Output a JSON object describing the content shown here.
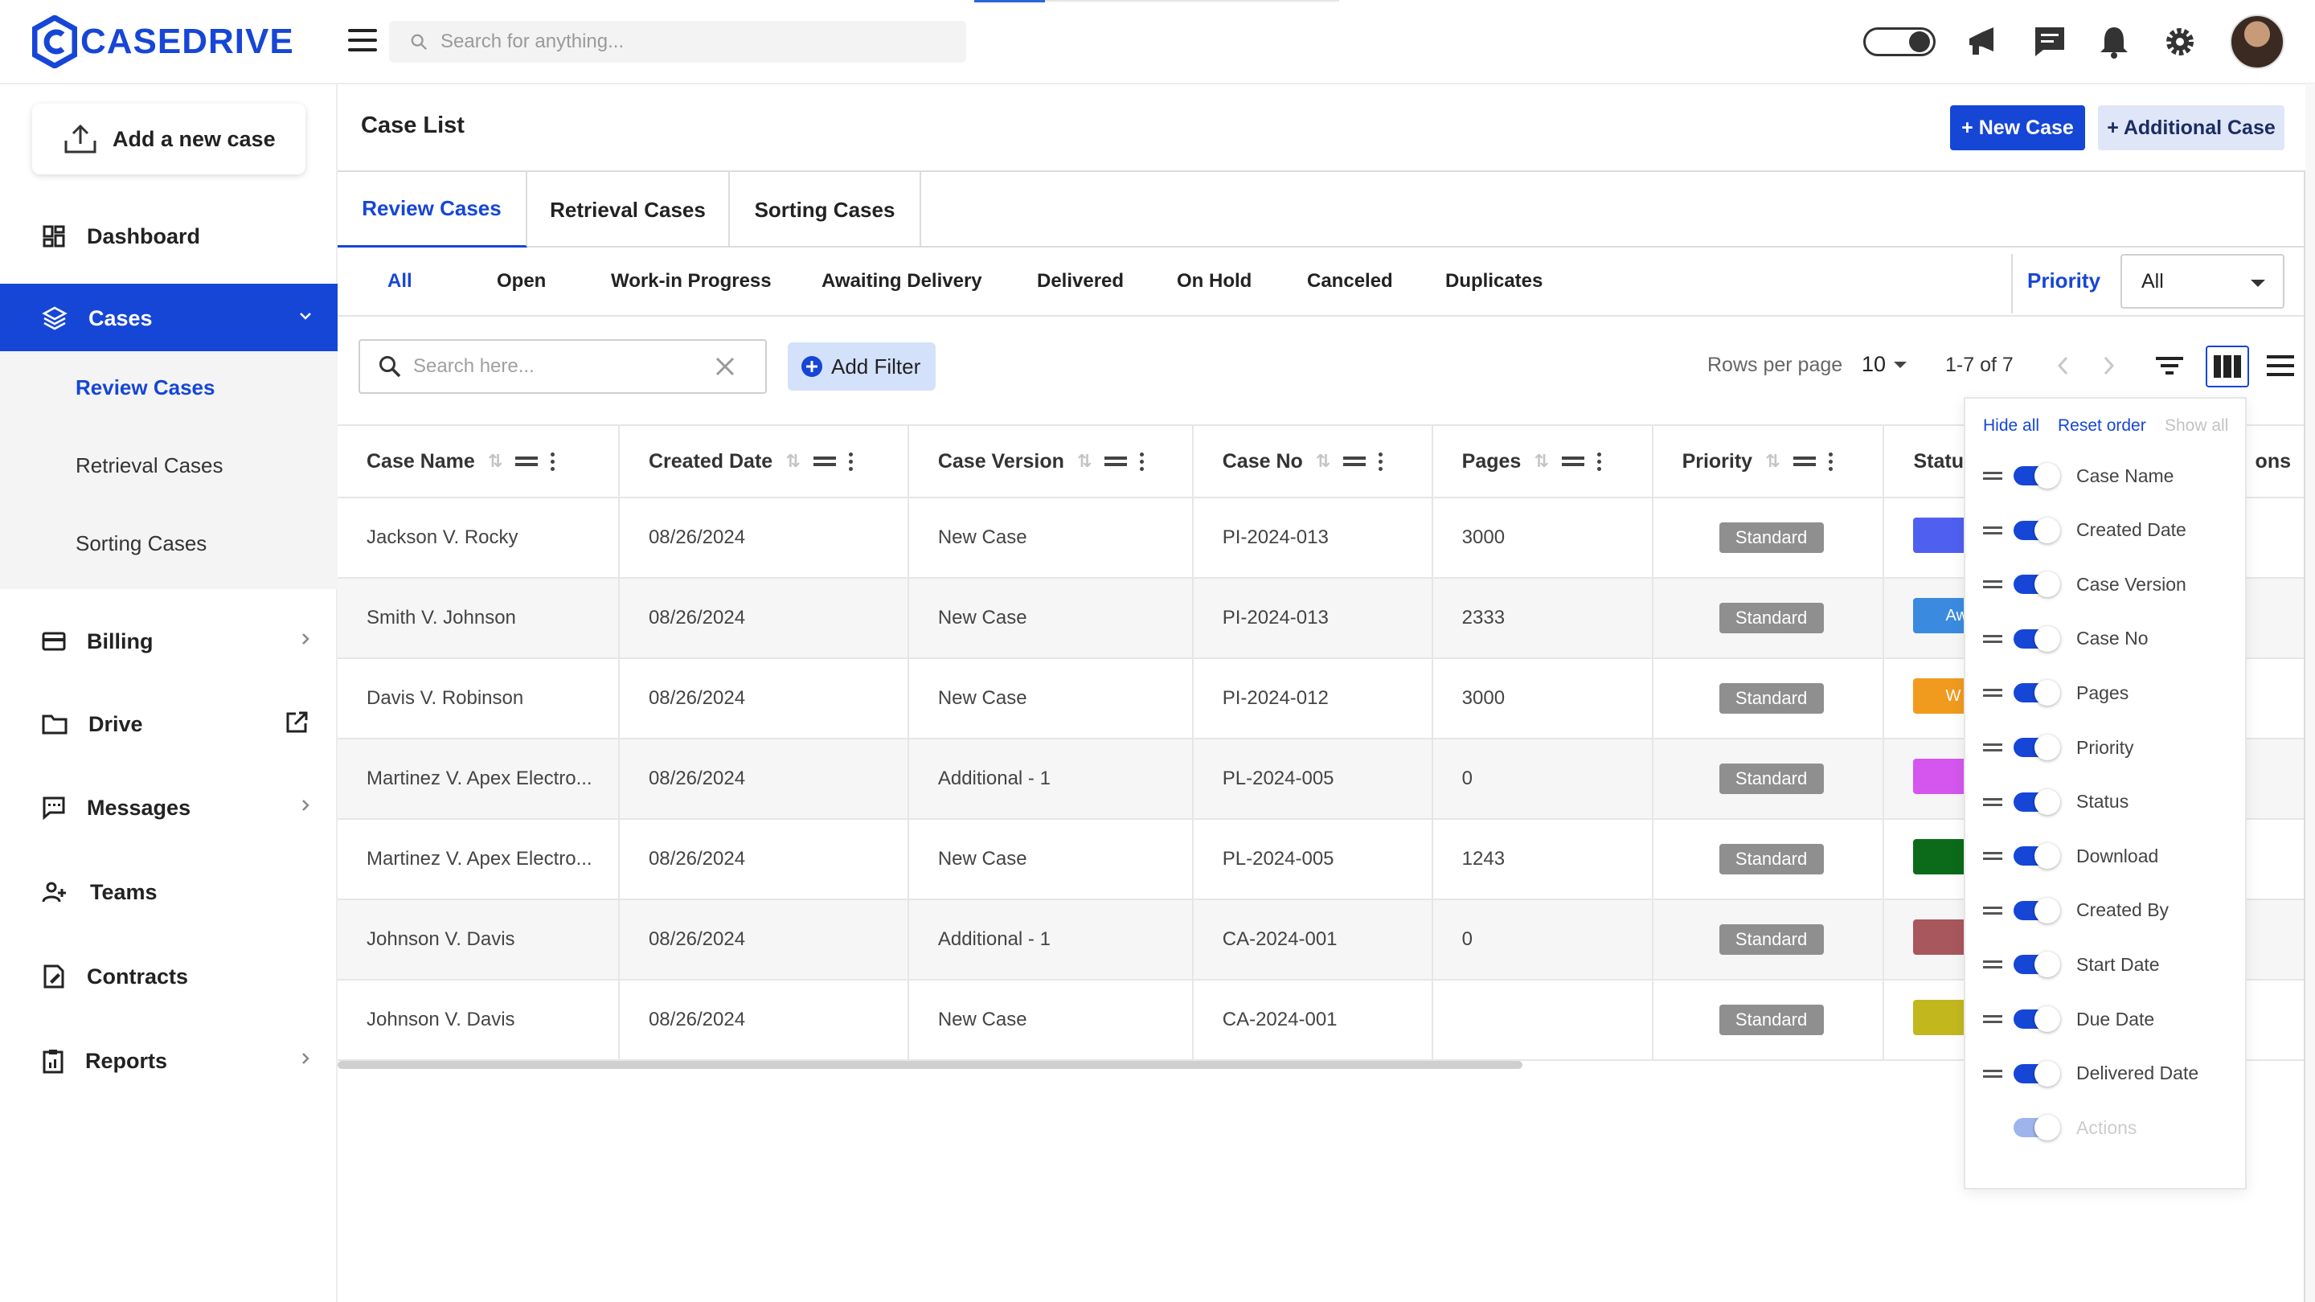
{
  "brand": {
    "logo_text": "CASEDRIVE",
    "accent": "#1646d6"
  },
  "topbar": {
    "search_placeholder": "Search for anything...",
    "icons": [
      "theme-toggle-icon",
      "megaphone-icon",
      "chat-icon",
      "bell-icon",
      "gear-icon",
      "avatar"
    ]
  },
  "sidebar": {
    "add_case_label": "Add a new case",
    "items": [
      {
        "label": "Dashboard",
        "icon": "dashboard-icon"
      },
      {
        "label": "Cases",
        "icon": "layers-icon"
      },
      {
        "label": "Billing",
        "icon": "card-icon"
      },
      {
        "label": "Drive",
        "icon": "folder-icon"
      },
      {
        "label": "Messages",
        "icon": "message-icon"
      },
      {
        "label": "Teams",
        "icon": "team-icon"
      },
      {
        "label": "Contracts",
        "icon": "contract-icon"
      },
      {
        "label": "Reports",
        "icon": "report-icon"
      }
    ],
    "cases_sub": [
      "Review Cases",
      "Retrieval Cases",
      "Sorting Cases"
    ]
  },
  "header": {
    "title": "Case List",
    "new_case_label": "+ New Case",
    "additional_case_label": "+ Additional Case"
  },
  "tabs": [
    "Review Cases",
    "Retrieval Cases",
    "Sorting Cases"
  ],
  "status_filters": [
    "All",
    "Open",
    "Work-in Progress",
    "Awaiting Delivery",
    "Delivered",
    "On Hold",
    "Canceled",
    "Duplicates"
  ],
  "priority": {
    "label": "Priority",
    "value": "All"
  },
  "toolbar": {
    "search_placeholder": "Search here...",
    "add_filter_label": "Add Filter",
    "rows_per_page_label": "Rows per page",
    "rows_per_page_value": "10",
    "page_range": "1-7 of 7"
  },
  "table": {
    "columns": [
      "Case Name",
      "Created Date",
      "Case Version",
      "Case No",
      "Pages",
      "Priority",
      "Statu",
      "ons"
    ],
    "rows": [
      {
        "case_name": "Jackson V. Rocky",
        "created": "08/26/2024",
        "version": "New Case",
        "case_no": "PI-2024-013",
        "pages": "3000",
        "priority": "Standard",
        "status_color": "#4f5ff0",
        "status_text": ""
      },
      {
        "case_name": "Smith V. Johnson",
        "created": "08/26/2024",
        "version": "New Case",
        "case_no": "PI-2024-013",
        "pages": "2333",
        "priority": "Standard",
        "status_color": "#3a8be0",
        "status_text": "Aw"
      },
      {
        "case_name": "Davis V. Robinson",
        "created": "08/26/2024",
        "version": "New Case",
        "case_no": "PI-2024-012",
        "pages": "3000",
        "priority": "Standard",
        "status_color": "#f09a1e",
        "status_text": "W"
      },
      {
        "case_name": "Martinez V. Apex Electro...",
        "created": "08/26/2024",
        "version": "Additional - 1",
        "case_no": "PL-2024-005",
        "pages": "0",
        "priority": "Standard",
        "status_color": "#d456ee",
        "status_text": ""
      },
      {
        "case_name": "Martinez V. Apex Electro...",
        "created": "08/26/2024",
        "version": "New Case",
        "case_no": "PL-2024-005",
        "pages": "1243",
        "priority": "Standard",
        "status_color": "#0b6b1a",
        "status_text": ""
      },
      {
        "case_name": "Johnson V. Davis",
        "created": "08/26/2024",
        "version": "Additional - 1",
        "case_no": "CA-2024-001",
        "pages": "0",
        "priority": "Standard",
        "status_color": "#a8575c",
        "status_text": ""
      },
      {
        "case_name": "Johnson V. Davis",
        "created": "08/26/2024",
        "version": "New Case",
        "case_no": "CA-2024-001",
        "pages": "",
        "priority": "Standard",
        "status_color": "#c2b81e",
        "status_text": ""
      }
    ]
  },
  "column_panel": {
    "hide_all": "Hide all",
    "reset_order": "Reset order",
    "show_all": "Show all",
    "columns": [
      {
        "name": "Case Name",
        "on": true
      },
      {
        "name": "Created Date",
        "on": true
      },
      {
        "name": "Case Version",
        "on": true
      },
      {
        "name": "Case No",
        "on": true
      },
      {
        "name": "Pages",
        "on": true
      },
      {
        "name": "Priority",
        "on": true
      },
      {
        "name": "Status",
        "on": true
      },
      {
        "name": "Download",
        "on": true
      },
      {
        "name": "Created By",
        "on": true
      },
      {
        "name": "Start Date",
        "on": true
      },
      {
        "name": "Due Date",
        "on": true
      },
      {
        "name": "Delivered Date",
        "on": true
      },
      {
        "name": "Actions",
        "on": true,
        "disabled": true
      }
    ]
  }
}
